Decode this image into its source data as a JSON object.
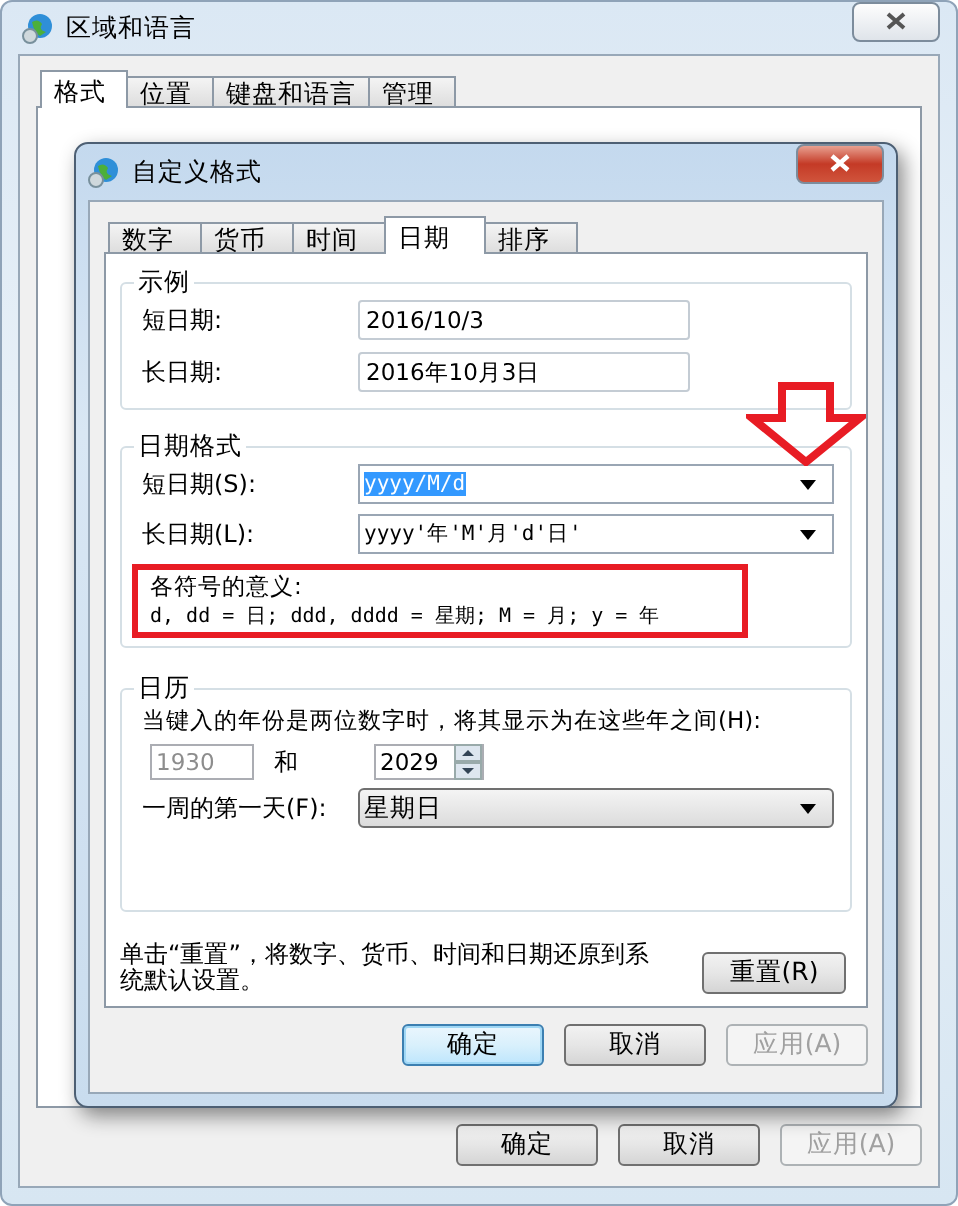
{
  "window": {
    "title": "区域和语言"
  },
  "tabs": [
    {
      "label": "格式",
      "selected": true
    },
    {
      "label": "位置",
      "selected": false
    },
    {
      "label": "键盘和语言",
      "selected": false
    },
    {
      "label": "管理",
      "selected": false
    }
  ],
  "buttons": [
    {
      "label": "确定",
      "default": false,
      "disabled": false
    },
    {
      "label": "取消",
      "default": false,
      "disabled": false
    },
    {
      "label": "应用(A)",
      "default": false,
      "disabled": true
    }
  ],
  "dialog": {
    "title": "自定义格式",
    "tabs": [
      {
        "label": "数字",
        "selected": false
      },
      {
        "label": "货币",
        "selected": false
      },
      {
        "label": "时间",
        "selected": false
      },
      {
        "label": "日期",
        "selected": true
      },
      {
        "label": "排序",
        "selected": false
      }
    ],
    "example": {
      "title": "示例",
      "rows": [
        {
          "label": "短日期:",
          "value": "2016/10/3"
        },
        {
          "label": "长日期:",
          "value": "2016年10月3日"
        }
      ]
    },
    "date_formats": {
      "title": "日期格式",
      "rows": [
        {
          "label": "短日期(S):",
          "value": "yyyy/M/d",
          "highlighted": true
        },
        {
          "label": "长日期(L):",
          "value": "yyyy'年'M'月'd'日'",
          "highlighted": false
        }
      ],
      "legend_title": "各符号的意义:",
      "legend": "d, dd = 日;  ddd, dddd = 星期;  M = 月;  y = 年"
    },
    "calendar": {
      "title": "日历",
      "prompt": "当键入的年份是两位数字时，将其显示为在这些年之间(H):",
      "from": {
        "value": "1930",
        "disabled": true
      },
      "and": "和",
      "to": {
        "value": "2029",
        "disabled": false
      },
      "first_day_label": "一周的第一天(F):",
      "first_day": "星期日"
    },
    "reset_note": "单击“重置”，将数字、货币、时间和日期还原到系统默认设置。",
    "reset_button": "重置(R)",
    "buttons": [
      {
        "label": "确定",
        "default": true,
        "disabled": false
      },
      {
        "label": "取消",
        "default": false,
        "disabled": false
      },
      {
        "label": "应用(A)",
        "default": false,
        "disabled": true
      }
    ]
  }
}
